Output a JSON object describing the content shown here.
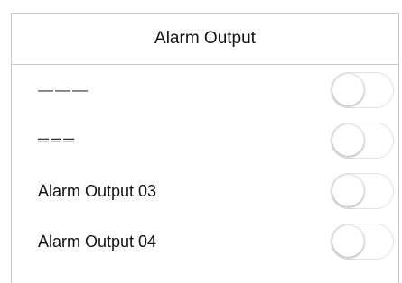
{
  "header": {
    "title": "Alarm Output"
  },
  "rows": [
    {
      "label": "———",
      "toggle_on": false
    },
    {
      "label": "═══",
      "toggle_on": false
    },
    {
      "label": "Alarm Output 03",
      "toggle_on": false
    },
    {
      "label": "Alarm Output 04",
      "toggle_on": false
    }
  ],
  "colors": {
    "border": "#c8c8cc",
    "text": "#111111",
    "toggle_off_bg": "#ffffff"
  }
}
